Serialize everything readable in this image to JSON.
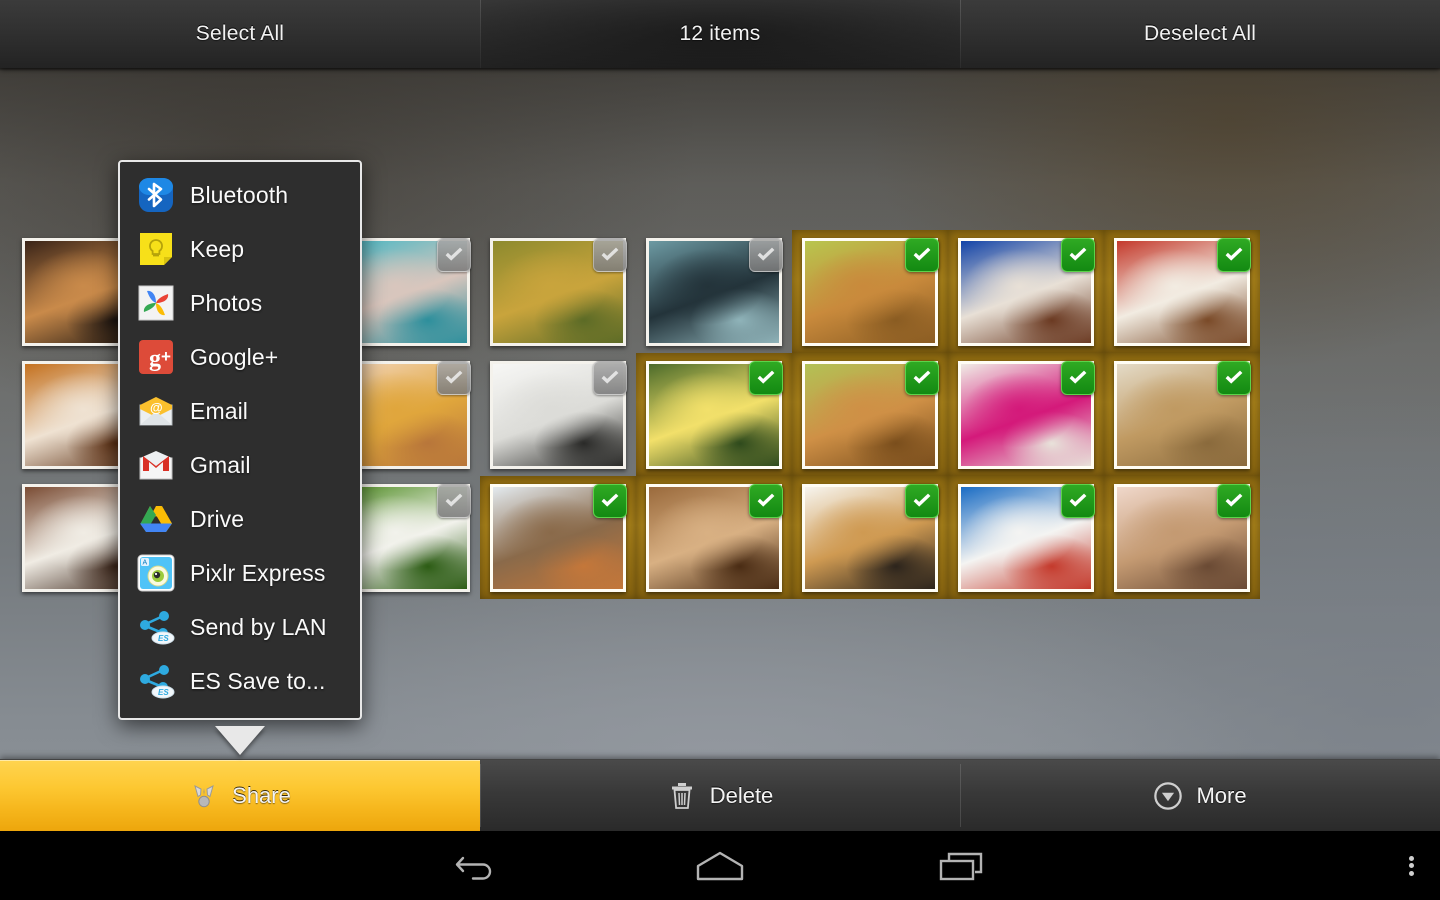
{
  "topbar": {
    "select_all": "Select All",
    "count": "12 items",
    "deselect_all": "Deselect All"
  },
  "share_menu": {
    "items": [
      {
        "label": "Bluetooth",
        "icon": "bluetooth-icon"
      },
      {
        "label": "Keep",
        "icon": "google-keep-icon"
      },
      {
        "label": "Photos",
        "icon": "google-photos-icon"
      },
      {
        "label": "Google+",
        "icon": "google-plus-icon"
      },
      {
        "label": "Email",
        "icon": "email-icon"
      },
      {
        "label": "Gmail",
        "icon": "gmail-icon"
      },
      {
        "label": "Drive",
        "icon": "google-drive-icon"
      },
      {
        "label": "Pixlr Express",
        "icon": "pixlr-express-icon"
      },
      {
        "label": "Send by LAN",
        "icon": "es-share-icon"
      },
      {
        "label": "ES Save to...",
        "icon": "es-share-icon"
      }
    ]
  },
  "actionbar": {
    "share": "Share",
    "delete": "Delete",
    "more": "More",
    "active_color": "#fdc832"
  },
  "gallery": {
    "columns": 9,
    "rows": 3,
    "selected_count": 12,
    "cells": [
      {
        "subject": "red-panda-closeup",
        "selected": false,
        "c1": "#3a2418",
        "c2": "#c98a4a",
        "c3": "#1c1410"
      },
      {
        "subject": "puppy-hidden-1",
        "selected": false,
        "c1": "#6b5a4a",
        "c2": "#d8c2a8",
        "c3": "#4a3b2e"
      },
      {
        "subject": "kissing-fish",
        "selected": false,
        "c1": "#46b7c4",
        "c2": "#d9c6bd",
        "c3": "#2d8f9c"
      },
      {
        "subject": "baby-owl",
        "selected": false,
        "c1": "#8d8a2e",
        "c2": "#c9a43c",
        "c3": "#5c6b26"
      },
      {
        "subject": "spider-web",
        "selected": false,
        "c1": "#6d9aa3",
        "c2": "#23333a",
        "c3": "#8fb3b9"
      },
      {
        "subject": "golden-retriever-1",
        "selected": true,
        "c1": "#b8c64e",
        "c2": "#c98a3c",
        "c3": "#8a5c22"
      },
      {
        "subject": "cocker-spaniel-blue",
        "selected": true,
        "c1": "#1344a8",
        "c2": "#e8e0d6",
        "c3": "#6b3a22"
      },
      {
        "subject": "papillon-red",
        "selected": true,
        "c1": "#c43a2c",
        "c2": "#f2ece2",
        "c3": "#7a4a28"
      },
      {
        "subject": "edge-blank-1",
        "selected": false,
        "c1": "#00000000",
        "c2": "#00000000",
        "c3": "#00000000"
      },
      {
        "subject": "red-panda-face",
        "selected": false,
        "c1": "#c4711f",
        "c2": "#efe2d2",
        "c3": "#5a2e12"
      },
      {
        "subject": "puppy-hidden-2",
        "selected": false,
        "c1": "#8a7a66",
        "c2": "#e2d4c0",
        "c3": "#5a4a38"
      },
      {
        "subject": "garfield-cat",
        "selected": false,
        "c1": "#f3d6bb",
        "c2": "#e0a63c",
        "c3": "#b8763a"
      },
      {
        "subject": "white-maltese-puppy",
        "selected": false,
        "c1": "#f7f7f5",
        "c2": "#dcdcd8",
        "c3": "#2a2a28"
      },
      {
        "subject": "yellow-duckling",
        "selected": true,
        "c1": "#4c6b2a",
        "c2": "#f2e06a",
        "c3": "#2e4a1c"
      },
      {
        "subject": "golden-retriever-2",
        "selected": true,
        "c1": "#b2c255",
        "c2": "#cf9046",
        "c3": "#7a4e1c"
      },
      {
        "subject": "chihuahua-pink-sweater",
        "selected": true,
        "c1": "#f0ece6",
        "c2": "#d4197a",
        "c3": "#e8e2da"
      },
      {
        "subject": "three-cocker-puppies",
        "selected": true,
        "c1": "#e4dbc8",
        "c2": "#c09a62",
        "c3": "#8a6a3c"
      },
      {
        "subject": "edge-blank-2",
        "selected": false,
        "c1": "#00000000",
        "c2": "#00000000",
        "c3": "#00000000"
      },
      {
        "subject": "cavalier-puppy",
        "selected": false,
        "c1": "#7a4c34",
        "c2": "#f0ece4",
        "c3": "#3a2418"
      },
      {
        "subject": "corgi-hidden",
        "selected": false,
        "c1": "#9a8a74",
        "c2": "#e8ddcb",
        "c3": "#5c4a36"
      },
      {
        "subject": "butterfly-on-leaf",
        "selected": false,
        "c1": "#4e8c22",
        "c2": "#f2f2ec",
        "c3": "#2c5c14"
      },
      {
        "subject": "flying-bird",
        "selected": true,
        "c1": "#e3eaef",
        "c2": "#8a6a4a",
        "c3": "#c4773a"
      },
      {
        "subject": "wet-golden-retriever",
        "selected": true,
        "c1": "#9a6a3c",
        "c2": "#d8b083",
        "c3": "#4a2c14"
      },
      {
        "subject": "dog-with-glasses",
        "selected": true,
        "c1": "#f7f5ef",
        "c2": "#cf9a52",
        "c3": "#2c241c"
      },
      {
        "subject": "white-chihuahua-blue",
        "selected": true,
        "c1": "#1a6cc4",
        "c2": "#f4f4f2",
        "c3": "#c43a2c"
      },
      {
        "subject": "sleeping-beagle",
        "selected": true,
        "c1": "#f0d8cb",
        "c2": "#c49a72",
        "c3": "#6a4a34"
      },
      {
        "subject": "edge-blank-3",
        "selected": false,
        "c1": "#00000000",
        "c2": "#00000000",
        "c3": "#00000000"
      }
    ]
  },
  "navbar": {
    "back": "back-icon",
    "home": "home-icon",
    "recents": "recent-apps-icon",
    "menu": "overflow-menu-icon"
  }
}
